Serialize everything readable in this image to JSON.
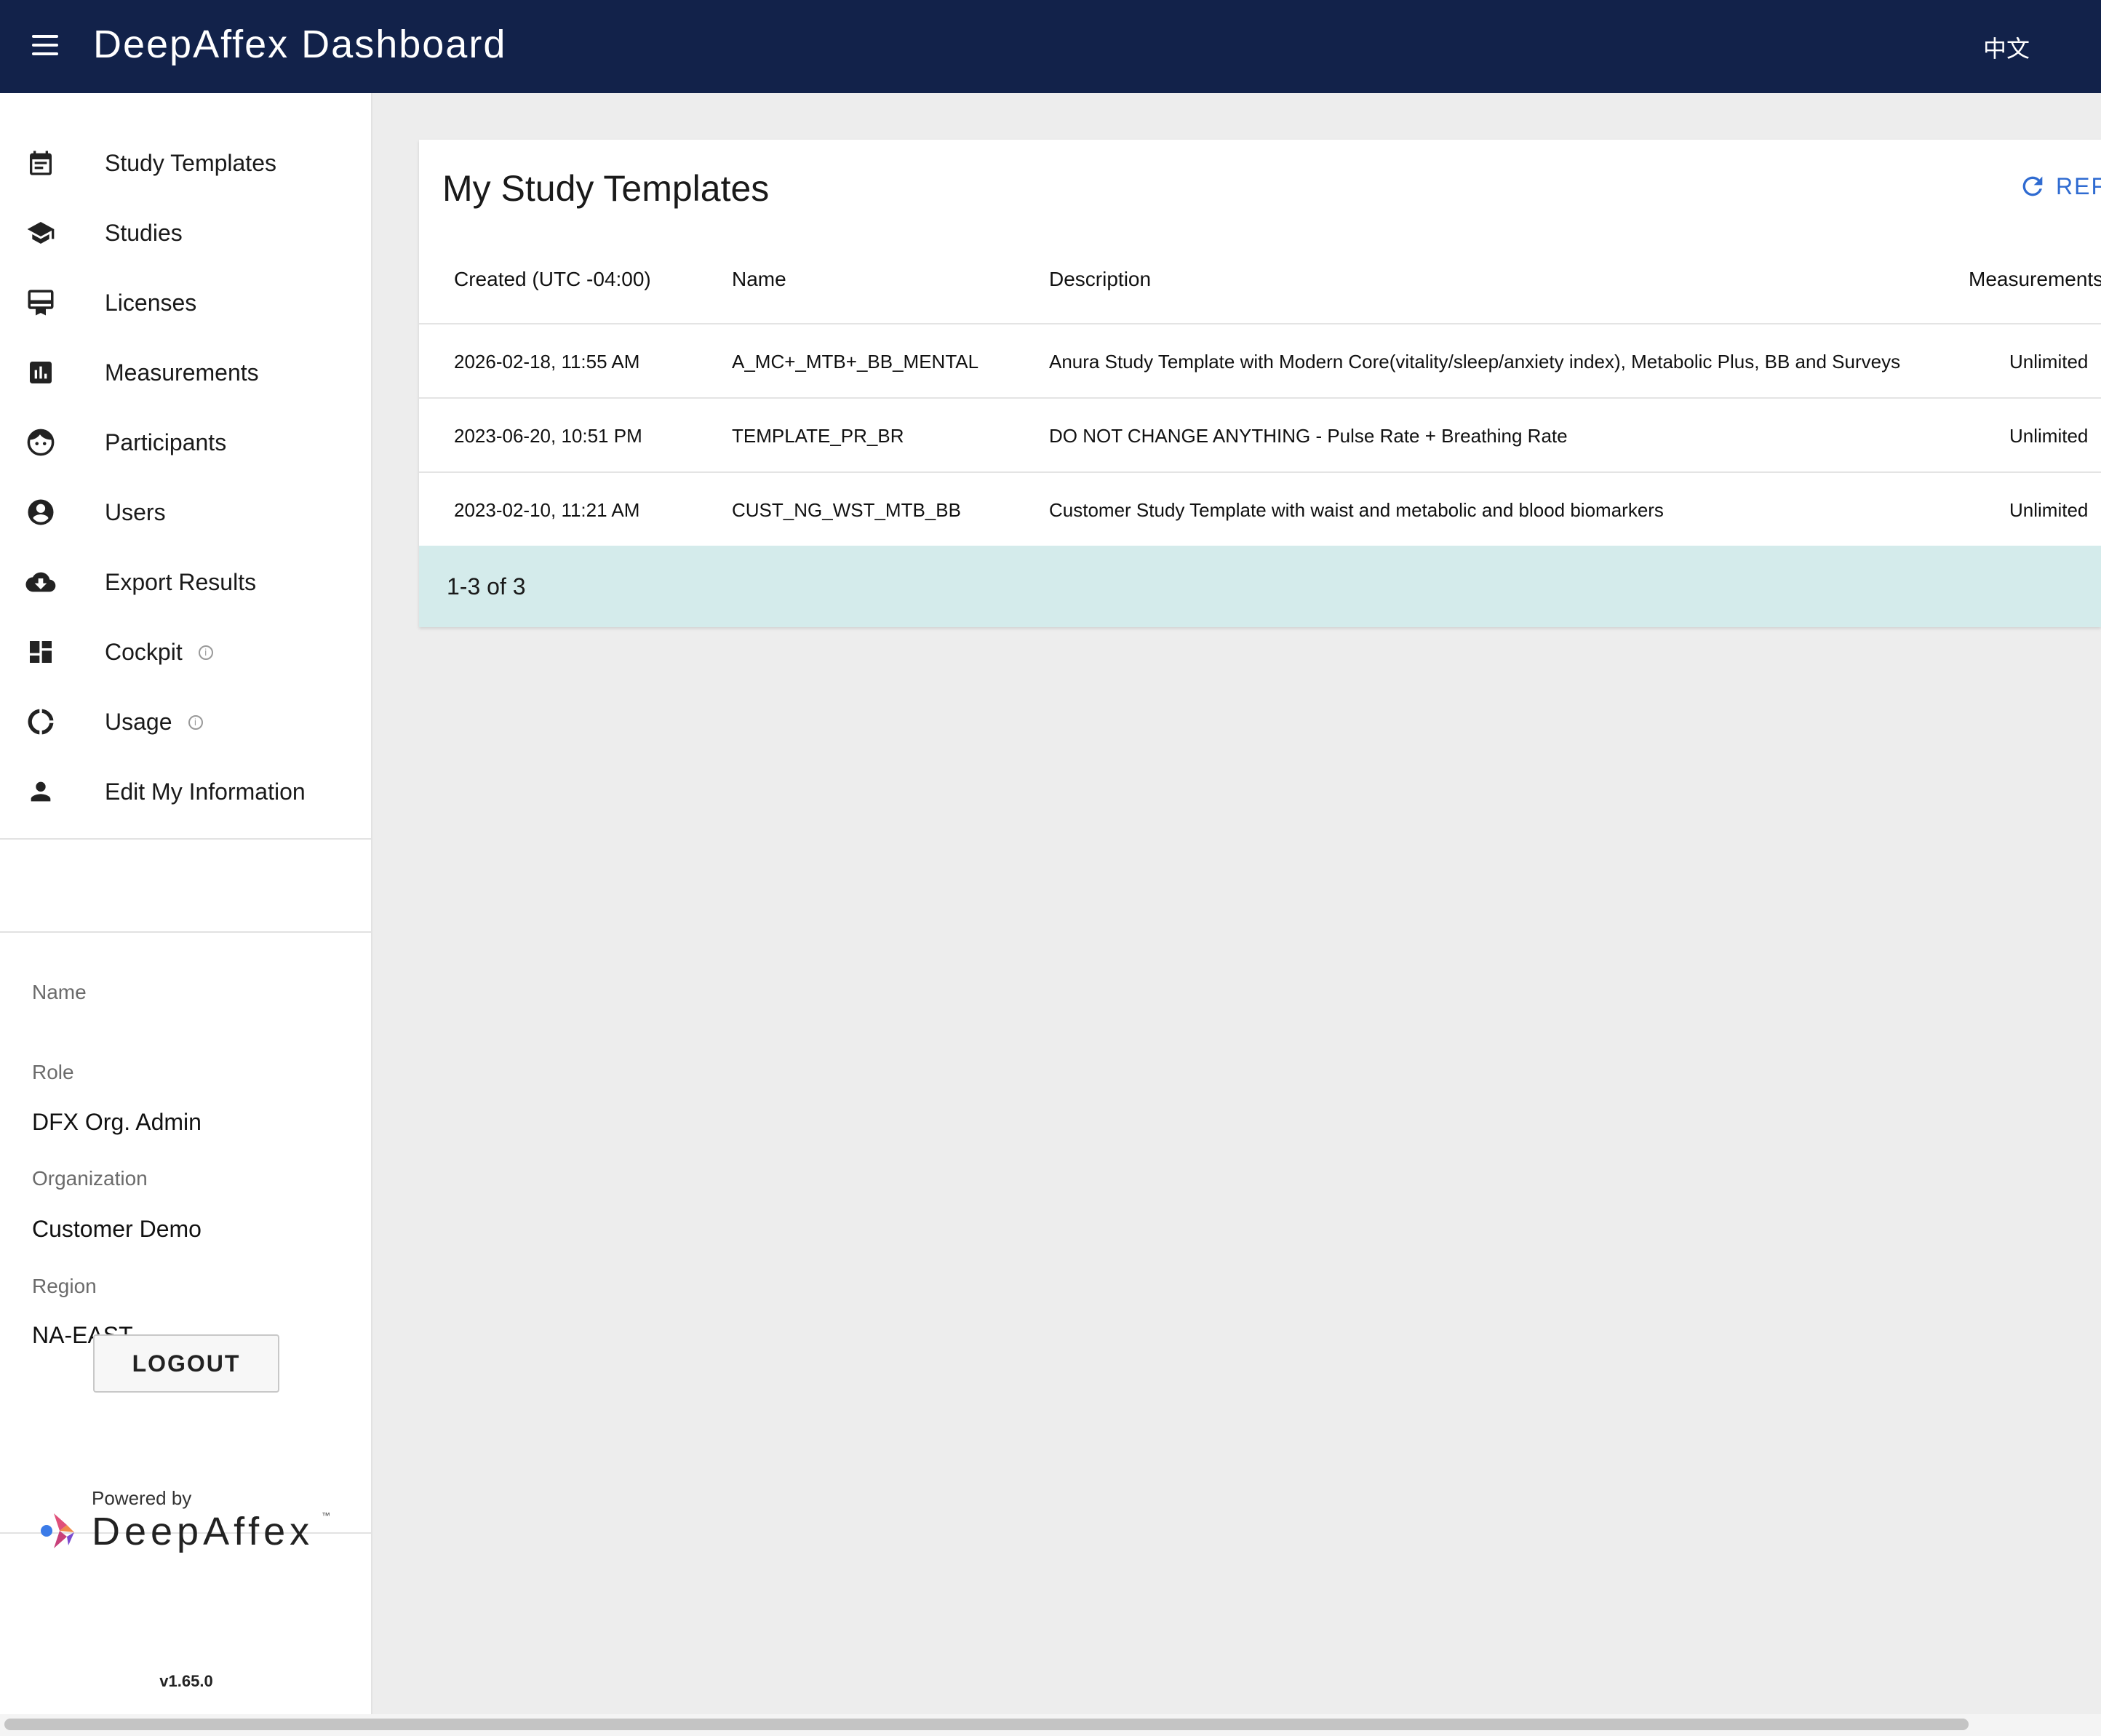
{
  "app": {
    "title": "DeepAffex Dashboard",
    "language_toggle": "中文"
  },
  "sidebar": {
    "items": [
      {
        "label": "Study Templates",
        "icon": "calendar-icon"
      },
      {
        "label": "Studies",
        "icon": "graduation-cap-icon"
      },
      {
        "label": "Licenses",
        "icon": "card-membership-icon"
      },
      {
        "label": "Measurements",
        "icon": "bar-chart-icon"
      },
      {
        "label": "Participants",
        "icon": "face-icon"
      },
      {
        "label": "Users",
        "icon": "account-circle-icon"
      },
      {
        "label": "Export Results",
        "icon": "cloud-download-icon"
      },
      {
        "label": "Cockpit",
        "icon": "dashboard-icon",
        "info": true
      },
      {
        "label": "Usage",
        "icon": "donut-icon",
        "info": true
      },
      {
        "label": "Edit My Information",
        "icon": "person-icon"
      }
    ],
    "info_glyph": "i",
    "user": {
      "name_label": "Name",
      "name_value": "",
      "role_label": "Role",
      "role_value": "DFX Org. Admin",
      "org_label": "Organization",
      "org_value": "Customer Demo",
      "region_label": "Region",
      "region_value": "NA-EAST"
    },
    "logout_label": "LOGOUT",
    "powered_by": "Powered by",
    "brand_name": "DeepAffex",
    "trademark": "™",
    "version": "v1.65.0"
  },
  "main": {
    "card_title": "My Study Templates",
    "refresh_label": "REFRESH",
    "table": {
      "headers": [
        "Created (UTC -04:00)",
        "Name",
        "Description",
        "Measurements"
      ],
      "rows": [
        [
          "2026-02-18, 11:55 AM",
          "A_MC+_MTB+_BB_MENTAL",
          "Anura Study Template with Modern Core(vitality/sleep/anxiety index), Metabolic Plus, BB and Surveys",
          "Unlimited"
        ],
        [
          "2023-06-20, 10:51 PM",
          "TEMPLATE_PR_BR",
          "DO NOT CHANGE ANYTHING - Pulse Rate + Breathing Rate",
          "Unlimited"
        ],
        [
          "2023-02-10, 11:21 AM",
          "CUST_NG_WST_MTB_BB",
          "Customer Study Template with waist and metabolic and blood biomarkers",
          "Unlimited"
        ]
      ]
    },
    "pagination": "1-3 of 3"
  },
  "colors": {
    "appbar": "#12224a",
    "accent": "#2f6bd1",
    "pager_bg": "#d4ebeb"
  }
}
